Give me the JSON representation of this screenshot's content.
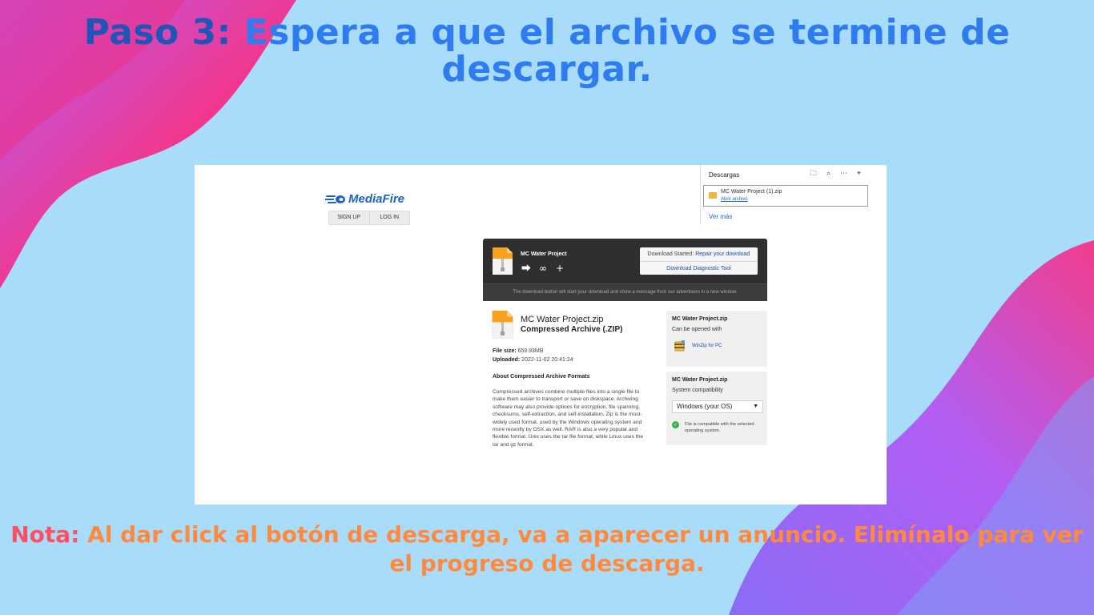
{
  "headline": {
    "lead": "Paso 3:",
    "text": " Espera a que el archivo se termine de descargar."
  },
  "note": {
    "lead": "Nota:",
    "text": " Al dar click al botón de descarga, va a aparecer un anuncio. Elimínalo para ver el progreso de descarga."
  },
  "colors": {
    "background": "#a8dcfa",
    "headline_lead": "#1e55b8",
    "headline": "#2f7cf0",
    "note_lead": "#ff4f61",
    "note": "#ff8a3d",
    "wave_pink": "#f23d8c",
    "wave_purple": "#b05cf2"
  },
  "mediafire": {
    "logo": "MediaFire",
    "signup": "SIGN UP",
    "login": "LOG IN"
  },
  "downloads_panel": {
    "title": "Descargas",
    "icons": [
      "folder-icon",
      "search-icon",
      "more-icon",
      "pin-icon"
    ],
    "item_name": "MC Water Project (1).zip",
    "item_action": "Abrir archivo",
    "see_more": "Ver más"
  },
  "download_box": {
    "project": "MC Water Project",
    "status_prefix": "Download Started: ",
    "status_link": "Repair your download",
    "diagnostic": "Download Diagnostic Tool",
    "hint": "The download button will start your download and show a message from our advertisers in a new window."
  },
  "file": {
    "name": "MC Water Project.zip",
    "type": "Compressed Archive (.ZIP)",
    "size_label": "File size:",
    "size": " 659.93MB",
    "uploaded_label": "Uploaded:",
    "uploaded": " 2022-11-02 20:41:24",
    "about_title": "About Compressed Archive Formats",
    "about_text": "Compressed archives combine multiple files into a single file to make them easier to transport or save on diskspace. Archiving software may also provide options for encryption, file spanning, checksums, self-extraction, and self-installation. Zip is the most-widely used format, used by the Windows operating system and more recently by OSX as well. RAR is also a very popular and flexible format. Unix uses the tar file format, while Linux uses the tar and gz format."
  },
  "open_with": {
    "title": "MC Water Project.zip",
    "subtitle": "Can be opened with",
    "app": "WinZip for PC"
  },
  "compat": {
    "title": "MC Water Project.zip",
    "subtitle": "System compatibility",
    "os": "Windows (your OS)",
    "message": "File is compatible with the selected operating system."
  }
}
